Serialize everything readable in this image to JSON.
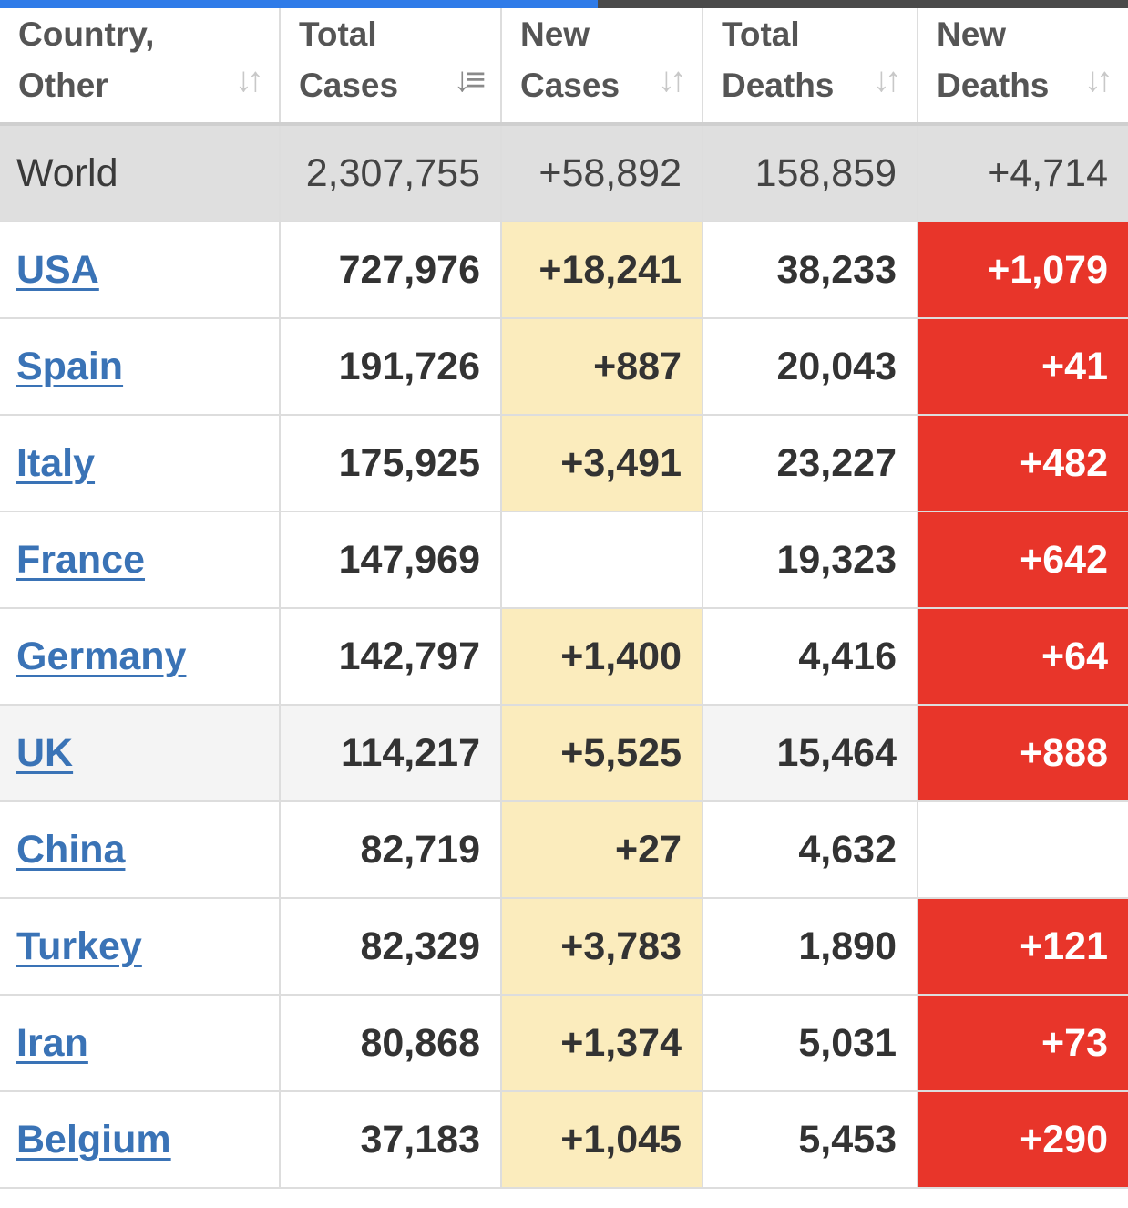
{
  "colors": {
    "new_cases_highlight": "#fbecbd",
    "new_deaths_highlight": "#e8352a",
    "link": "#3a73b6",
    "progress_bar": "#2f7be8"
  },
  "page_load_progress": 0.53,
  "table": {
    "headers": [
      {
        "line1": "Country,",
        "line2": "Other",
        "sort_icon": "sort-both-icon"
      },
      {
        "line1": "Total",
        "line2": "Cases",
        "sort_icon": "sort-descending-icon"
      },
      {
        "line1": "New",
        "line2": "Cases",
        "sort_icon": "sort-both-icon"
      },
      {
        "line1": "Total",
        "line2": "Deaths",
        "sort_icon": "sort-both-icon"
      },
      {
        "line1": "New",
        "line2": "Deaths",
        "sort_icon": "sort-both-icon"
      }
    ],
    "world": {
      "country": "World",
      "total_cases": "2,307,755",
      "new_cases": "+58,892",
      "total_deaths": "158,859",
      "new_deaths": "+4,714"
    },
    "rows": [
      {
        "country": "USA",
        "total_cases": "727,976",
        "new_cases": "+18,241",
        "total_deaths": "38,233",
        "new_deaths": "+1,079"
      },
      {
        "country": "Spain",
        "total_cases": "191,726",
        "new_cases": "+887",
        "total_deaths": "20,043",
        "new_deaths": "+41"
      },
      {
        "country": "Italy",
        "total_cases": "175,925",
        "new_cases": "+3,491",
        "total_deaths": "23,227",
        "new_deaths": "+482"
      },
      {
        "country": "France",
        "total_cases": "147,969",
        "new_cases": "",
        "total_deaths": "19,323",
        "new_deaths": "+642"
      },
      {
        "country": "Germany",
        "total_cases": "142,797",
        "new_cases": "+1,400",
        "total_deaths": "4,416",
        "new_deaths": "+64"
      },
      {
        "country": "UK",
        "total_cases": "114,217",
        "new_cases": "+5,525",
        "total_deaths": "15,464",
        "new_deaths": "+888"
      },
      {
        "country": "China",
        "total_cases": "82,719",
        "new_cases": "+27",
        "total_deaths": "4,632",
        "new_deaths": ""
      },
      {
        "country": "Turkey",
        "total_cases": "82,329",
        "new_cases": "+3,783",
        "total_deaths": "1,890",
        "new_deaths": "+121"
      },
      {
        "country": "Iran",
        "total_cases": "80,868",
        "new_cases": "+1,374",
        "total_deaths": "5,031",
        "new_deaths": "+73"
      },
      {
        "country": "Belgium",
        "total_cases": "37,183",
        "new_cases": "+1,045",
        "total_deaths": "5,453",
        "new_deaths": "+290"
      }
    ]
  }
}
